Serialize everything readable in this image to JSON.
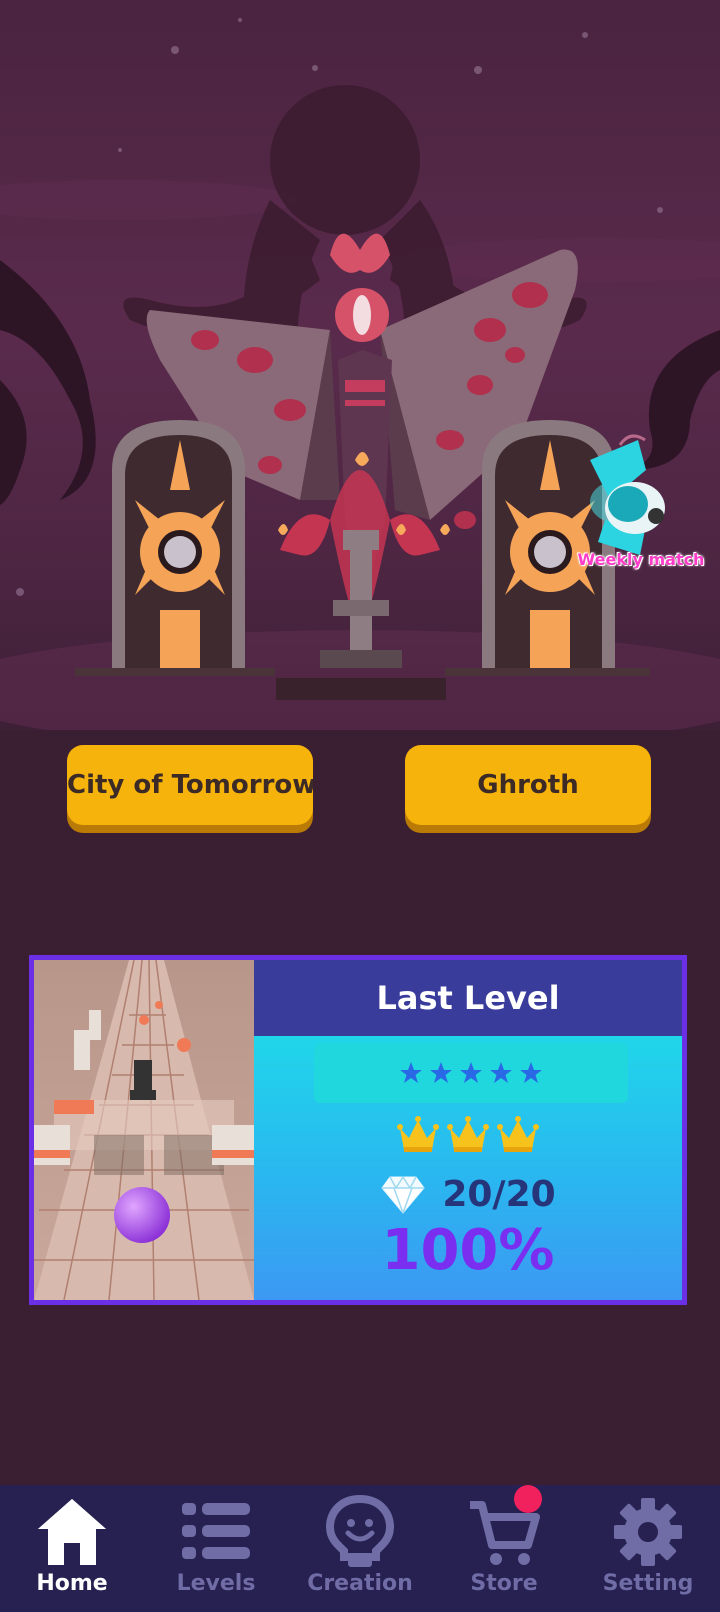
{
  "worlds": {
    "left_label": "City of Tomorrow",
    "right_label": "Ghroth"
  },
  "weekly_match": {
    "label": "Weekly match"
  },
  "last_level": {
    "title": "Last Level",
    "stars": 5,
    "crowns": 3,
    "gems": "20/20",
    "percent": "100%"
  },
  "tabs": [
    {
      "label": "Home",
      "icon": "home-icon",
      "active": true
    },
    {
      "label": "Levels",
      "icon": "list-icon",
      "active": false
    },
    {
      "label": "Creation",
      "icon": "lightbulb-icon",
      "active": false
    },
    {
      "label": "Store",
      "icon": "cart-icon",
      "active": false,
      "badge": true
    },
    {
      "label": "Setting",
      "icon": "gear-icon",
      "active": false
    }
  ],
  "colors": {
    "button": "#f5b30c",
    "card_border": "#6b2fe6",
    "card_header": "#3a3c9c",
    "percent": "#7a2ff0",
    "tabbar": "#262150",
    "badge": "#f0215d"
  }
}
